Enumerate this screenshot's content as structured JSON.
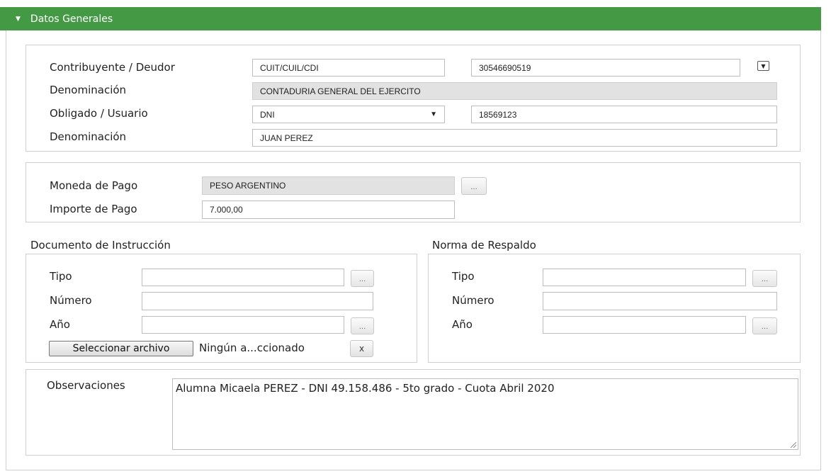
{
  "section": {
    "title": "Datos Generales",
    "header_color": "#449a44"
  },
  "contribuyente": {
    "label": "Contribuyente / Deudor",
    "doc_type": "CUIT/CUIL/CDI",
    "doc_number": "30546690519",
    "denominacion_label": "Denominación",
    "denominacion_value": "CONTADURIA GENERAL DEL EJERCITO"
  },
  "obligado": {
    "label": "Obligado / Usuario",
    "doc_type": "DNI",
    "doc_number": "18569123",
    "denominacion_label": "Denominación",
    "denominacion_value": "JUAN PEREZ"
  },
  "pago": {
    "moneda_label": "Moneda de Pago",
    "moneda_value": "PESO ARGENTINO",
    "importe_label": "Importe de Pago",
    "importe_value": "7.000,00",
    "lookup_button": "..."
  },
  "documento_instruccion": {
    "title": "Documento de Instrucción",
    "tipo_label": "Tipo",
    "tipo_value": "",
    "numero_label": "Número",
    "numero_value": "",
    "anio_label": "Año",
    "anio_value": "",
    "lookup_button": "...",
    "file_button": "Seleccionar archivo",
    "file_status": "Ningún a...ccionado",
    "clear_button": "x"
  },
  "norma_respaldo": {
    "title": "Norma de Respaldo",
    "tipo_label": "Tipo",
    "tipo_value": "",
    "numero_label": "Número",
    "numero_value": "",
    "anio_label": "Año",
    "anio_value": "",
    "lookup_button": "..."
  },
  "observaciones": {
    "label": "Observaciones",
    "value": "Alumna Micaela PEREZ - DNI 49.158.486 - 5to grado -  Cuota Abril 2020"
  },
  "icons": {
    "header_caret": "▼",
    "dropdown_arrow": "▼"
  }
}
